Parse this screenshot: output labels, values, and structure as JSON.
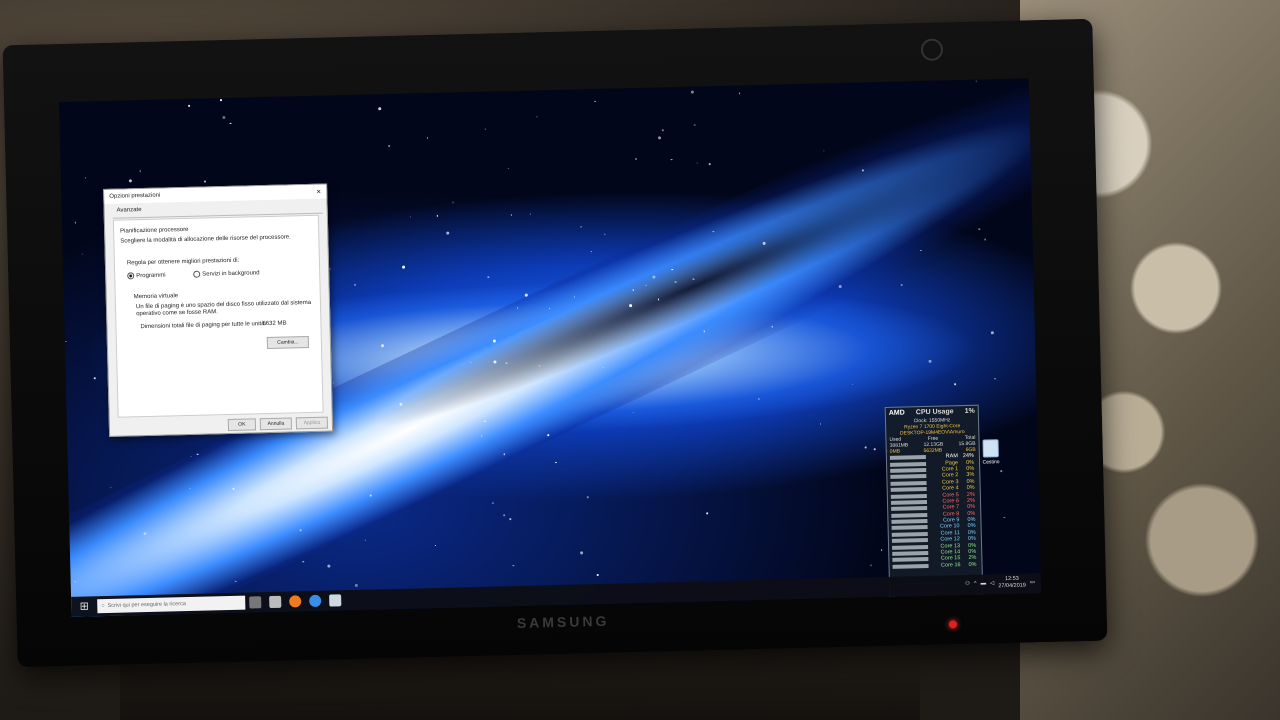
{
  "dialog": {
    "title": "Opzioni prestazioni",
    "tab": "Avanzate",
    "section1_title": "Pianificazione processore",
    "section1_desc": "Scegliere la modalità di allocazione delle risorse del processore.",
    "section1_sub": "Regola per ottenere migliori prestazioni di:",
    "radio_programs": "Programmi",
    "radio_background": "Servizi in background",
    "section2_title": "Memoria virtuale",
    "section2_desc1": "Un file di paging è uno spazio del disco fisso utilizzato dal sistema",
    "section2_desc2": "operativo come se fosse RAM.",
    "paging_label": "Dimensioni totali file di paging per tutte le unità:",
    "paging_value": "5632 MB",
    "change_button": "Cambia...",
    "ok_button": "OK",
    "cancel_button": "Annulla",
    "apply_button": "Applica"
  },
  "desktop": {
    "recycle_bin_label": "Cestino"
  },
  "gadget": {
    "title": "CPU Usage",
    "total_pct": "1%",
    "vendor": "AMD",
    "clock": "Clock: 1550MHz",
    "cpu_name": "Ryzen 7 1700 Eight-Core",
    "host": "DESKTOP-19M4EOV\\Amuro",
    "mem_headers": [
      "Used",
      "Free",
      "Total"
    ],
    "mem_values": [
      "3881MB",
      "12.13GB",
      "15.9GB"
    ],
    "page_values": [
      "0MB",
      "5632MB",
      "6GB"
    ],
    "rows": [
      {
        "label": "RAM",
        "pct": "24%"
      },
      {
        "label": "Page",
        "pct": "0%"
      },
      {
        "label": "Core 1",
        "pct": "0%"
      },
      {
        "label": "Core 2",
        "pct": "3%"
      },
      {
        "label": "Core 3",
        "pct": "0%"
      },
      {
        "label": "Core 4",
        "pct": "0%"
      },
      {
        "label": "Core 5",
        "pct": "2%"
      },
      {
        "label": "Core 6",
        "pct": "2%"
      },
      {
        "label": "Core 7",
        "pct": "0%"
      },
      {
        "label": "Core 8",
        "pct": "0%"
      },
      {
        "label": "Core 9",
        "pct": "0%"
      },
      {
        "label": "Core 10",
        "pct": "0%"
      },
      {
        "label": "Core 11",
        "pct": "0%"
      },
      {
        "label": "Core 12",
        "pct": "0%"
      },
      {
        "label": "Core 13",
        "pct": "0%"
      },
      {
        "label": "Core 14",
        "pct": "0%"
      },
      {
        "label": "Core 15",
        "pct": "2%"
      },
      {
        "label": "Core 16",
        "pct": "0%"
      }
    ],
    "row_colors": [
      "#ffffff",
      "#e8c84a",
      "#e8c84a",
      "#e8c84a",
      "#e8c84a",
      "#e8c84a",
      "#ff6a6a",
      "#ff6a6a",
      "#ff6a6a",
      "#ff6a6a",
      "#7fd0ff",
      "#7fd0ff",
      "#7fd0ff",
      "#7fd0ff",
      "#8fe88f",
      "#8fe88f",
      "#8fe88f",
      "#8fe88f"
    ]
  },
  "taskbar": {
    "search_placeholder": "Scrivi qui per eseguire la ricerca",
    "time": "12:53",
    "date": "27/04/2019"
  },
  "monitor": {
    "brand": "SAMSUNG"
  }
}
